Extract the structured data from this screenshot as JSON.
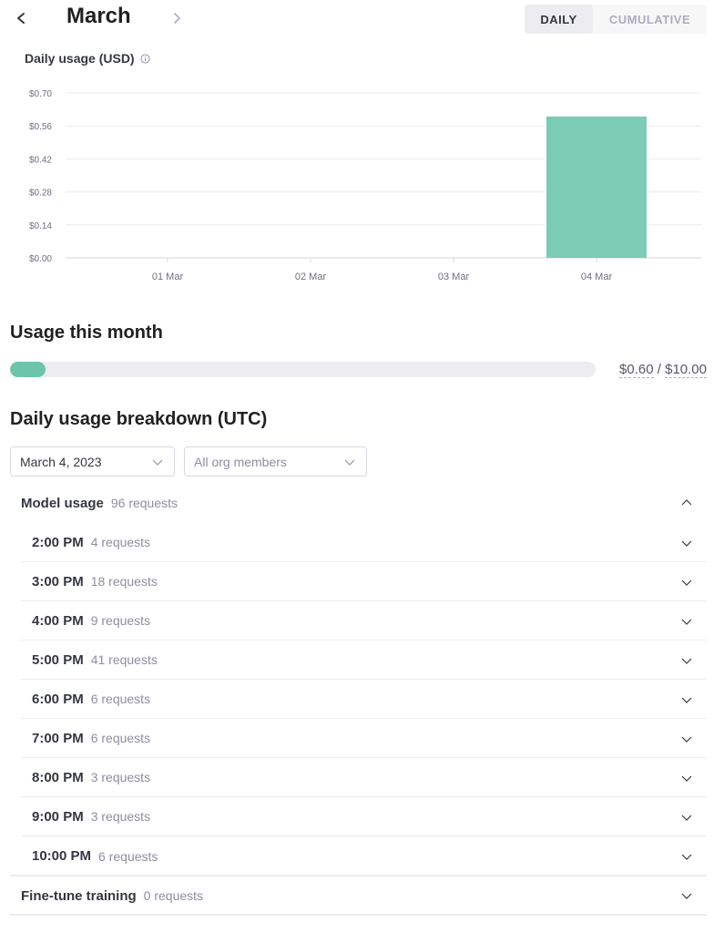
{
  "header": {
    "month": "March",
    "prev_icon": "chevron-left-icon",
    "next_icon": "chevron-right-icon",
    "toggle": {
      "options": [
        "DAILY",
        "CUMULATIVE"
      ],
      "selected": "DAILY"
    }
  },
  "chart_section": {
    "title": "Daily usage (USD)",
    "info_icon": "info-icon"
  },
  "chart_data": {
    "type": "bar",
    "title": "Daily usage (USD)",
    "xlabel": "",
    "ylabel": "",
    "categories": [
      "01 Mar",
      "02 Mar",
      "03 Mar",
      "04 Mar"
    ],
    "values": [
      0,
      0,
      0,
      0.6
    ],
    "ylim": [
      0,
      0.7
    ],
    "yticks": [
      "$0.00",
      "$0.14",
      "$0.28",
      "$0.42",
      "$0.56",
      "$0.70"
    ],
    "ytick_values": [
      0,
      0.14,
      0.28,
      0.42,
      0.56,
      0.7
    ],
    "grid": true,
    "bar_color": "#7ccbb5"
  },
  "usage_month": {
    "title": "Usage this month",
    "used": "$0.60",
    "limit": "$10.00",
    "separator": " / ",
    "progress_fraction": 0.06,
    "fill_color": "#6cc4aa"
  },
  "breakdown": {
    "title": "Daily usage breakdown (UTC)",
    "date_select": "March 4, 2023",
    "members_select": "All org members",
    "model_usage": {
      "label": "Model usage",
      "count": "96 requests",
      "expanded": true,
      "hours": [
        {
          "time": "2:00 PM",
          "count": "4 requests"
        },
        {
          "time": "3:00 PM",
          "count": "18 requests"
        },
        {
          "time": "4:00 PM",
          "count": "9 requests"
        },
        {
          "time": "5:00 PM",
          "count": "41 requests"
        },
        {
          "time": "6:00 PM",
          "count": "6 requests"
        },
        {
          "time": "7:00 PM",
          "count": "6 requests"
        },
        {
          "time": "8:00 PM",
          "count": "3 requests"
        },
        {
          "time": "9:00 PM",
          "count": "3 requests"
        },
        {
          "time": "10:00 PM",
          "count": "6 requests"
        }
      ]
    },
    "fine_tune": {
      "label": "Fine-tune training",
      "count": "0 requests",
      "expanded": false
    }
  }
}
